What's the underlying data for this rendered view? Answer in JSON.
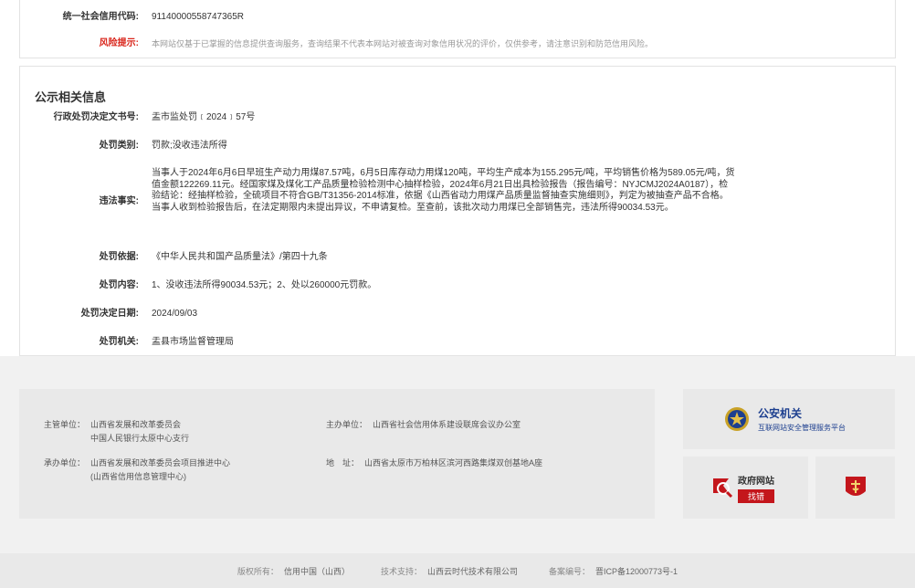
{
  "top": {
    "credit_code_label": "统一社会信用代码:",
    "credit_code_value": "91140000558747365R",
    "risk_label": "风险提示:",
    "risk_text": "本网站仅基于已掌握的信息提供查询服务，查询结果不代表本网站对被查询对象信用状况的评价，仅供参考，请注意识别和防范信用风险。"
  },
  "section": {
    "title": "公示相关信息",
    "rows": [
      {
        "label": "行政处罚决定文书号:",
        "value": "盂市监处罚﹝2024﹞57号"
      },
      {
        "label": "处罚类别:",
        "value": "罚款;没收违法所得"
      },
      {
        "label": "违法事实:",
        "value": "当事人于2024年6月6日早班生产动力用煤87.57吨，6月5日库存动力用煤120吨，平均生产成本为155.295元/吨，平均销售价格为589.05元/吨，货值金额122269.11元。经国家煤及煤化工产品质量检验检测中心抽样检验，2024年6月21日出具检验报告（报告编号：NYJCMJ2024A0187），检验结论：经抽样检验，全硫项目不符合GB/T31356-2014标准，依据《山西省动力用煤产品质量监督抽查实施细则》，判定为被抽查产品不合格。当事人收到检验报告后，在法定期限内未提出异议，不申请复检。至查前，该批次动力用煤已全部销售完，违法所得90034.53元。"
      },
      {
        "label": "处罚依据:",
        "value": "《中华人民共和国产品质量法》/第四十九条"
      },
      {
        "label": "处罚内容:",
        "value": "1、没收违法所得90034.53元；2、处以260000元罚款。"
      },
      {
        "label": "处罚决定日期:",
        "value": "2024/09/03"
      },
      {
        "label": "处罚机关:",
        "value": "盂县市场监督管理局"
      }
    ]
  },
  "footer": {
    "supervisor_label": "主管单位：",
    "supervisor_1": "山西省发展和改革委员会",
    "supervisor_2": "中国人民银行太原中心支行",
    "organizer_label": "主办单位：",
    "organizer": "山西省社会信用体系建设联席会议办公室",
    "undertaker_label": "承办单位：",
    "undertaker_1": "山西省发展和改革委员会项目推进中心",
    "undertaker_2": "(山西省信用信息管理中心)",
    "address_label": "地　址：",
    "address": "山西省太原市万柏林区滨河西路集煤双创基地A座",
    "police_title": "公安机关",
    "police_sub": "互联网站安全管理服务平台",
    "gov_site": "政府网站",
    "gov_error": "找错"
  },
  "copyright": {
    "rights_label": "版权所有：",
    "rights": "信用中国（山西）",
    "tech_label": "技术支持：",
    "tech": "山西云时代技术有限公司",
    "icp_label": "备案编号：",
    "icp": "晋ICP备12000773号-1"
  },
  "colors": {
    "risk": "#d9261c",
    "police_blue": "#1d3f8f",
    "gov_red": "#c4161c"
  }
}
